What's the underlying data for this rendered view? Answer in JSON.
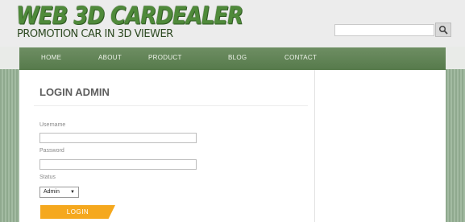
{
  "header": {
    "logo_title": "WEB 3D CARDEALER",
    "logo_subtitle": "PROMOTION CAR IN 3D VIEWER",
    "search_placeholder": ""
  },
  "nav": {
    "items": [
      "HOME",
      "ABOUT",
      "PRODUCT",
      "BLOG",
      "CONTACT"
    ]
  },
  "login": {
    "title": "LOGIN ADMIN",
    "username_label": "Username",
    "username_value": "",
    "password_label": "Password",
    "password_value": "",
    "status_label": "Status",
    "status_selected": "Admin",
    "button_label": "LOGIN"
  },
  "icons": {
    "search": "search-icon",
    "dropdown": "triangle-down-icon"
  },
  "colors": {
    "nav_green": "#5f8154",
    "logo_green": "#4f8a3a",
    "login_button": "#f5a81e"
  }
}
